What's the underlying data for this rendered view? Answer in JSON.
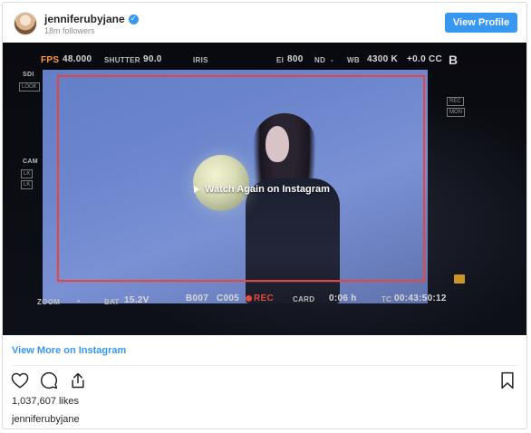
{
  "header": {
    "username": "jenniferubyjane",
    "verified_icon": "check",
    "followers": "18m followers",
    "view_profile_label": "View Profile"
  },
  "video": {
    "overlay": "Watch Again on Instagram",
    "hud": {
      "fps_label": "FPS",
      "fps_value": "48.000",
      "shutter_label": "SHUTTER",
      "shutter_value": "90.0",
      "iris_label": "IRIS",
      "ei_label": "EI",
      "ei_value": "800",
      "nd_label": "ND",
      "nd_value": "-",
      "wb_label": "WB",
      "wb_value": "4300 K",
      "cc_value": "+0.0 CC",
      "corner_letter": "B",
      "sdi_label": "SDI",
      "sdi_box": "LOOK",
      "cam_label": "CAM",
      "cam_box1": "LK",
      "cam_box2": "LK",
      "right_box1": "REC",
      "right_box2": "MON",
      "zoom_label": "ZOOM",
      "zoom_value": "-",
      "bat_label": "BAT",
      "bat_value": "15.2V",
      "reel": "B007",
      "clip": "C005",
      "rec": "REC",
      "card_label": "CARD",
      "card_value": "0:06 h",
      "tc_label": "TC",
      "tc_value": "00:43:50:12"
    }
  },
  "view_more_label": "View More on Instagram",
  "likes": "1,037,607 likes",
  "caption_username": "jenniferubyjane",
  "icons": {
    "heart": "heart-icon",
    "comment": "comment-icon",
    "share": "share-icon",
    "bookmark": "bookmark-icon"
  },
  "colors": {
    "accent": "#3897f0",
    "rec_red": "#e34a3a",
    "hud_orange": "#ff9c3a"
  }
}
